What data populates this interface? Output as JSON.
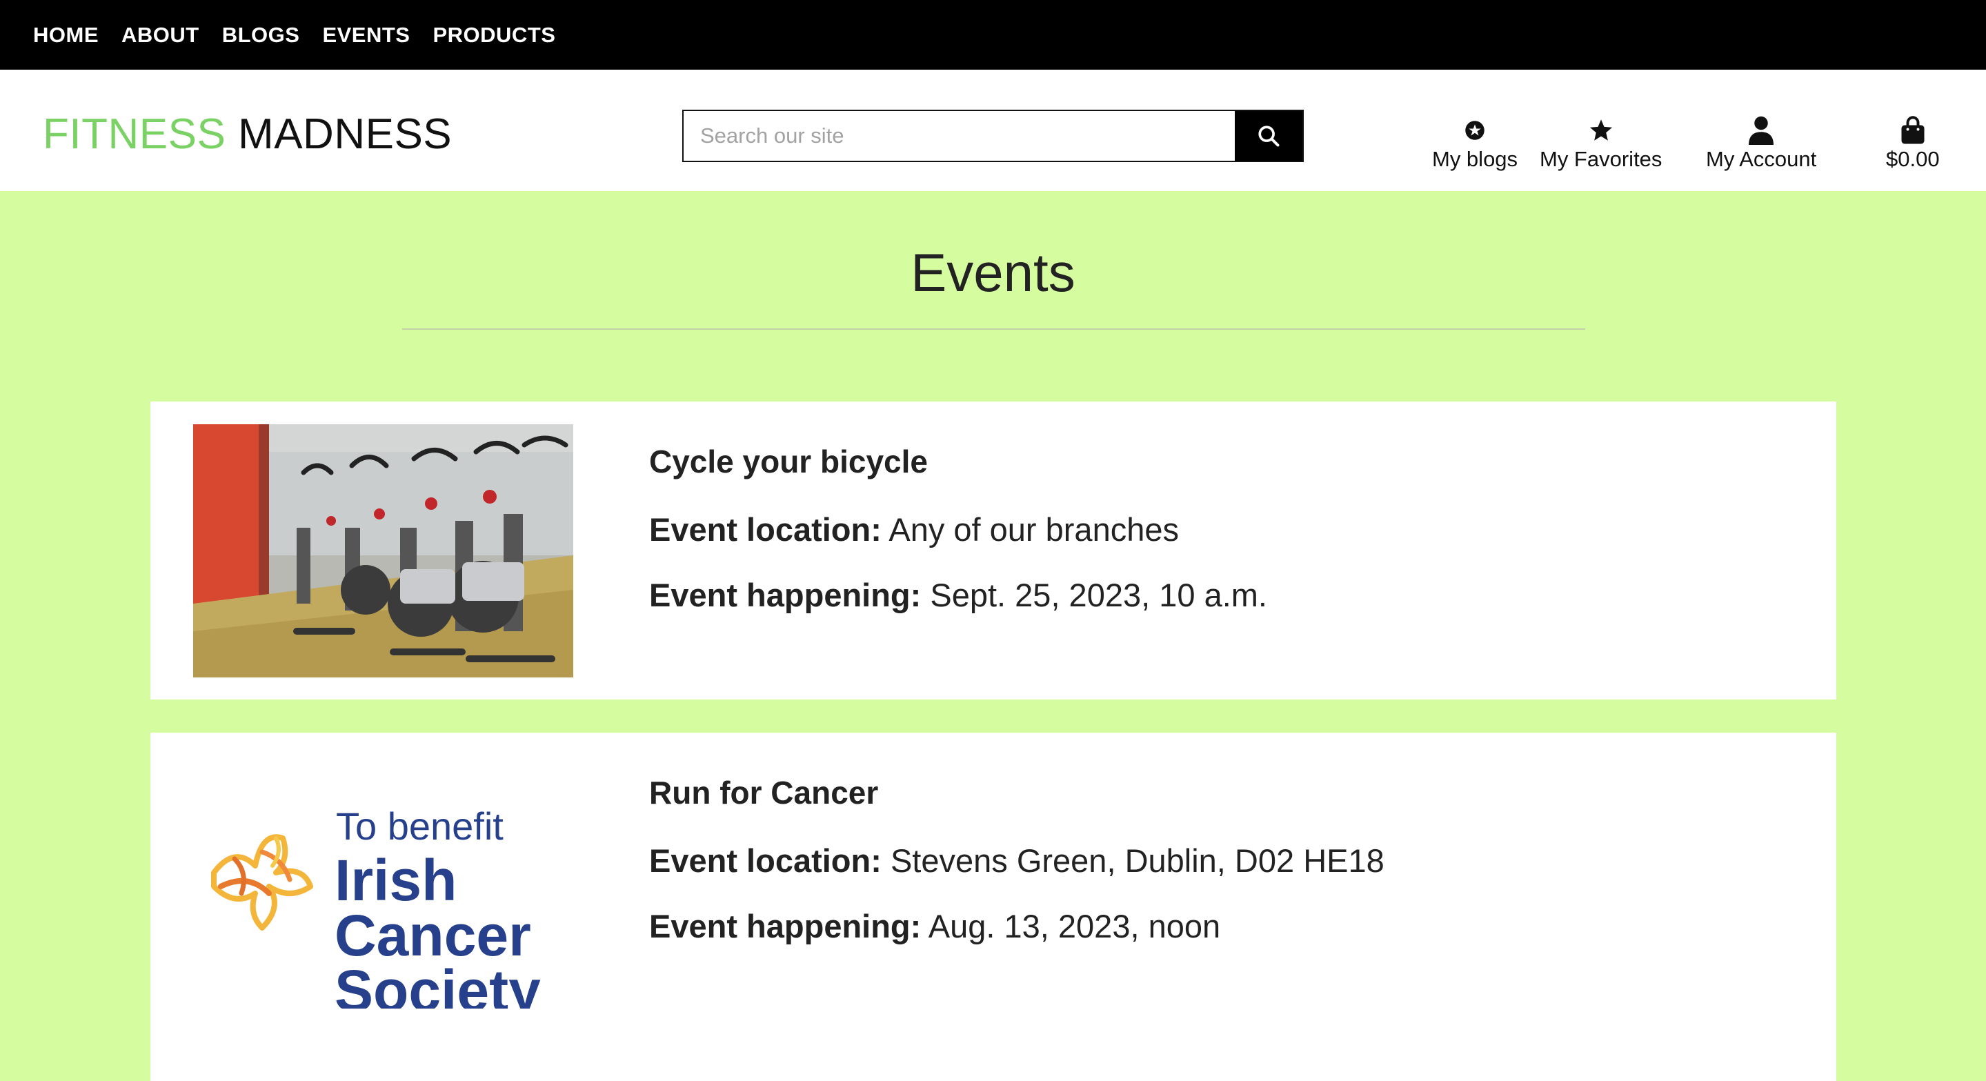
{
  "topnav": {
    "items": [
      "HOME",
      "ABOUT",
      "BLOGS",
      "EVENTS",
      "PRODUCTS"
    ]
  },
  "header": {
    "logo_part1": "FITNESS",
    "logo_part2": "MADNESS",
    "search_placeholder": "Search our site",
    "my_blogs": "My blogs",
    "my_favorites": "My Favorites",
    "my_account": "My Account",
    "cart_total": "$0.00"
  },
  "main": {
    "title": "Events",
    "events": [
      {
        "name": "Cycle your bicycle",
        "location_label": "Event location:",
        "location": "Any of our branches",
        "date_label": "Event happening:",
        "date": "Sept. 25, 2023, 10 a.m."
      },
      {
        "name": "Run for Cancer",
        "location_label": "Event location:",
        "location": "Stevens Green, Dublin, D02 HE18",
        "date_label": "Event happening:",
        "date": "Aug. 13, 2023, noon",
        "logo_text": [
          "To benefit",
          "Irish",
          "Cancer",
          "Society"
        ]
      }
    ]
  },
  "colors": {
    "page_bg": "#d5fc9f",
    "brand_green": "#7ad164",
    "nav_bg": "#000000",
    "ics_blue": "#27408b"
  }
}
